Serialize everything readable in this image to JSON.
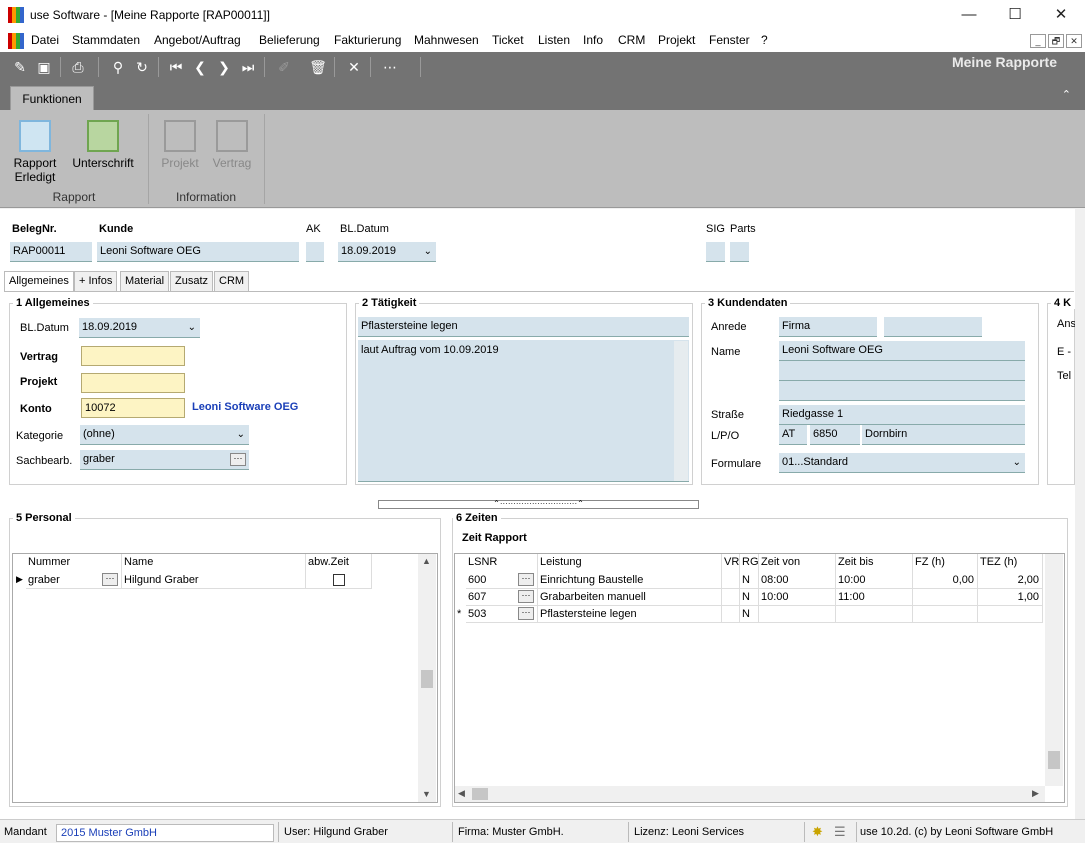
{
  "window": {
    "title": "use Software - [Meine Rapporte [RAP00011]]",
    "min": "—",
    "max": "☐",
    "close": "✕"
  },
  "menu": [
    "Datei",
    "Stammdaten",
    "Angebot/Auftrag",
    "Belieferung",
    "Fakturierung",
    "Mahnwesen",
    "Ticket",
    "Listen",
    "Info",
    "CRM",
    "Projekt",
    "Fenster",
    "?"
  ],
  "mdi_buttons": [
    "_",
    "🗗",
    "✕"
  ],
  "toolbar": {
    "page_title": "Meine Rapporte"
  },
  "ribbon": {
    "tab": "Funktionen",
    "rapport_erledigt": "Rapport\nErledigt",
    "rapport_erledigt_l1": "Rapport",
    "rapport_erledigt_l2": "Erledigt",
    "unterschrift": "Unterschrift",
    "group_rapport": "Rapport",
    "projekt": "Projekt",
    "vertrag": "Vertrag",
    "group_information": "Information"
  },
  "header": {
    "belegnr_label": "BelegNr.",
    "belegnr": "RAP00011",
    "kunde_label": "Kunde",
    "kunde": "Leoni Software OEG",
    "ak_label": "AK",
    "ak": "",
    "bldatum_label": "BL.Datum",
    "bldatum": "18.09.2019",
    "sig_label": "SIG",
    "parts_label": "Parts"
  },
  "tabs": [
    "Allgemeines",
    "+ Infos",
    "Material",
    "Zusatz",
    "CRM"
  ],
  "allgemeines": {
    "title": "1 Allgemeines",
    "bldatum_label": "BL.Datum",
    "bldatum": "18.09.2019",
    "vertrag_label": "Vertrag",
    "vertrag": "",
    "projekt_label": "Projekt",
    "projekt": "",
    "konto_label": "Konto",
    "konto": "10072",
    "konto_name": "Leoni Software OEG",
    "kategorie_label": "Kategorie",
    "kategorie": "(ohne)",
    "sachbearb_label": "Sachbearb.",
    "sachbearb": "graber"
  },
  "taetigkeit": {
    "title": "2 Tätigkeit",
    "betreff": "Pflastersteine legen",
    "text": "laut Auftrag vom 10.09.2019"
  },
  "kundendaten": {
    "title": "3 Kundendaten",
    "anrede_label": "Anrede",
    "anrede": "Firma",
    "anrede2": "",
    "name_label": "Name",
    "name1": "Leoni Software OEG",
    "name2": "",
    "name3": "",
    "strasse_label": "Straße",
    "strasse": "Riedgasse 1",
    "lpo_label": "L/P/O",
    "land": "AT",
    "plz": "6850",
    "ort": "Dornbirn",
    "formulare_label": "Formulare",
    "formulare": "01...Standard"
  },
  "panel4": {
    "title": "4 K",
    "l1": "Ans",
    "l2": "E -",
    "l3": "Tel"
  },
  "personal": {
    "title": "5 Personal",
    "columns": [
      "Nummer",
      "Name",
      "abw.Zeit"
    ],
    "rows": [
      {
        "nummer": "graber",
        "name": "Hilgund Graber"
      }
    ]
  },
  "zeiten": {
    "title": "6 Zeiten",
    "subtitle": "Zeit Rapport",
    "columns": [
      "LSNR",
      "Leistung",
      "VR",
      "RG",
      "Zeit von",
      "Zeit bis",
      "FZ (h)",
      "TEZ (h)"
    ],
    "rows": [
      {
        "lsnr": "600",
        "leistung": "Einrichtung Baustelle",
        "vr": "",
        "rg": "N",
        "von": "08:00",
        "bis": "10:00",
        "fz": "0,00",
        "tez": "2,00"
      },
      {
        "lsnr": "607",
        "leistung": "Grabarbeiten manuell",
        "vr": "",
        "rg": "N",
        "von": "10:00",
        "bis": "11:00",
        "fz": "",
        "tez": "1,00"
      },
      {
        "lsnr": "503",
        "leistung": "Pflastersteine legen",
        "vr": "",
        "rg": "N",
        "von": "",
        "bis": "",
        "fz": "",
        "tez": ""
      }
    ],
    "new_row_marker": "*"
  },
  "status": {
    "mandant_label": "Mandant",
    "mandant": "2015 Muster GmbH",
    "user": "User: Hilgund Graber",
    "firma": "Firma: Muster GmbH.",
    "lizenz": "Lizenz: Leoni Services",
    "version": "use 10.2d. (c) by Leoni Software GmbH"
  }
}
